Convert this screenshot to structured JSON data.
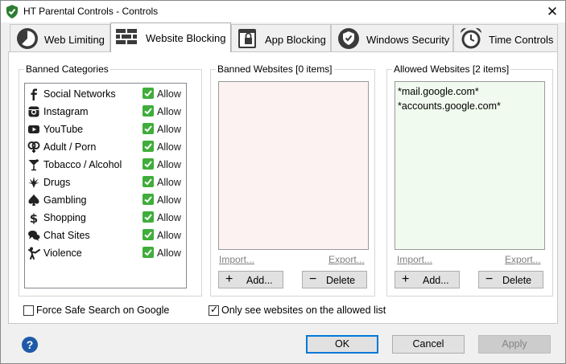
{
  "window": {
    "title": "HT Parental Controls - Controls",
    "close_glyph": "✕"
  },
  "tabs": [
    {
      "label": "Web Limiting",
      "icon": "pie-clock-icon",
      "active": false
    },
    {
      "label": "Website Blocking",
      "icon": "brick-wall-icon",
      "active": true
    },
    {
      "label": "App Blocking",
      "icon": "app-lock-icon",
      "active": false
    },
    {
      "label": "Windows Security",
      "icon": "shield-check-icon",
      "active": false
    },
    {
      "label": "Time Controls",
      "icon": "alarm-clock-icon",
      "active": false
    }
  ],
  "banned_categories": {
    "title": "Banned Categories",
    "items": [
      {
        "name": "Social Networks",
        "icon": "facebook-icon",
        "status": "Allow"
      },
      {
        "name": "Instagram",
        "icon": "instagram-icon",
        "status": "Allow"
      },
      {
        "name": "YouTube",
        "icon": "youtube-icon",
        "status": "Allow"
      },
      {
        "name": "Adult / Porn",
        "icon": "adult-icon",
        "status": "Allow"
      },
      {
        "name": "Tobacco / Alcohol",
        "icon": "cocktail-icon",
        "status": "Allow"
      },
      {
        "name": "Drugs",
        "icon": "leaf-icon",
        "status": "Allow"
      },
      {
        "name": "Gambling",
        "icon": "spade-icon",
        "status": "Allow"
      },
      {
        "name": "Shopping",
        "icon": "dollar-icon",
        "status": "Allow"
      },
      {
        "name": "Chat Sites",
        "icon": "chat-icon",
        "status": "Allow"
      },
      {
        "name": "Violence",
        "icon": "martial-arts-icon",
        "status": "Allow"
      }
    ]
  },
  "banned_websites": {
    "title": "Banned Websites [0 items]",
    "items": [],
    "import_label": "Import...",
    "export_label": "Export...",
    "add_label": "Add...",
    "delete_label": "Delete"
  },
  "allowed_websites": {
    "title": "Allowed Websites [2 items]",
    "items": [
      "*mail.google.com*",
      "*accounts.google.com*"
    ],
    "import_label": "Import...",
    "export_label": "Export...",
    "add_label": "Add...",
    "delete_label": "Delete"
  },
  "options": {
    "force_safe_search": {
      "label": "Force Safe Search on Google",
      "checked": false
    },
    "only_allowed": {
      "label": "Only see websites on the allowed list",
      "checked": true
    }
  },
  "footer": {
    "help_glyph": "?",
    "ok_label": "OK",
    "cancel_label": "Cancel",
    "apply_label": "Apply"
  },
  "colors": {
    "accent": "#0078d7",
    "allow_green": "#3fad3a",
    "banned_bg": "#fcf2f2",
    "allowed_bg": "#f1faee",
    "help_blue": "#1e5aa8"
  }
}
